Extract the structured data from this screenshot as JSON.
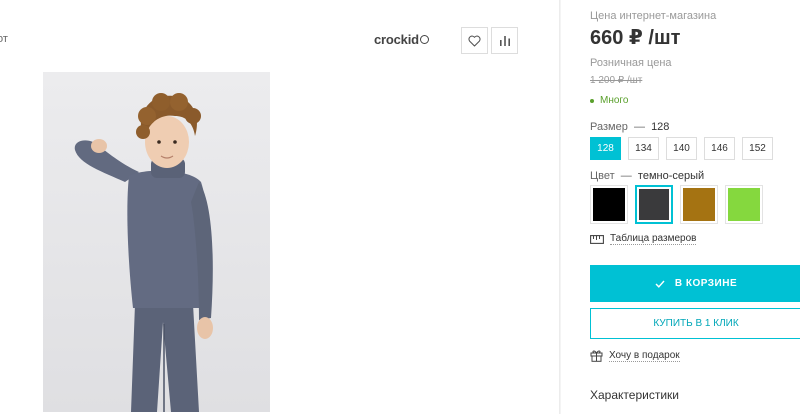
{
  "product": {
    "cut_text": "от",
    "brand": "crockid",
    "photo_alt": "Фото товара"
  },
  "pricing": {
    "label": "Цена интернет-магазина",
    "price": "660 ₽ /шт",
    "retail_label": "Розничная цена",
    "retail_price": "1 200 ₽ /шт",
    "stock": "Много"
  },
  "size": {
    "label": "Размер",
    "dash": "—",
    "selected": "128",
    "options": [
      "128",
      "134",
      "140",
      "146",
      "152"
    ]
  },
  "color": {
    "label": "Цвет",
    "dash": "—",
    "selected": "темно-серый",
    "swatches": [
      "#000000",
      "#3a3a3c",
      "#a57312",
      "#85d83e"
    ]
  },
  "size_table": "Таблица размеров",
  "actions": {
    "cart": "В КОРЗИНЕ",
    "one_click": "КУПИТЬ В 1 КЛИК",
    "gift": "Хочу в подарок"
  },
  "characteristics": "Характеристики",
  "colors": {
    "accent": "#00c1d4",
    "stock": "#5aa02c"
  },
  "icons": {
    "favorite": "heart-icon",
    "compare": "bar-chart-icon",
    "stock": "dot-icon",
    "ruler": "ruler-icon",
    "check": "check-icon",
    "gift": "gift-icon"
  }
}
